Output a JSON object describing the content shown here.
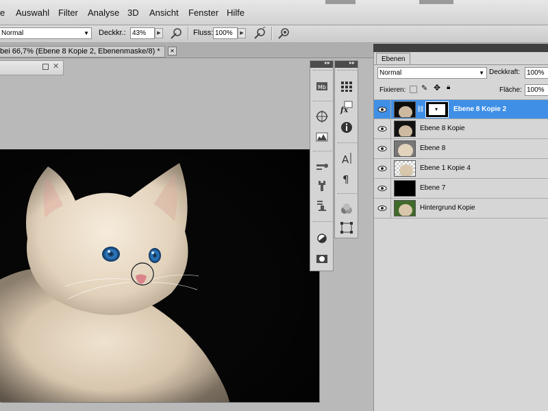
{
  "menu": {
    "items": [
      "e",
      "Auswahl",
      "Filter",
      "Analyse",
      "3D",
      "Ansicht",
      "Fenster",
      "Hilfe"
    ]
  },
  "options": {
    "mode_value": "Normal",
    "opacity_label": "Deckkr.:",
    "opacity_value": "43%",
    "flow_label": "Fluss:",
    "flow_value": "100%"
  },
  "document": {
    "tab_title": "bei 66,7% (Ebene 8 Kopie 2, Ebenenmaske/8) *",
    "close_glyph": "✕"
  },
  "layers_panel": {
    "tab_label": "Ebenen",
    "blend_mode": "Normal",
    "opacity_label": "Deckkraft:",
    "opacity_value": "100%",
    "lock_label": "Fixieren:",
    "fill_label": "Fläche:",
    "fill_value": "100%",
    "layers": [
      {
        "name": "Ebene 8 Kopie 2",
        "selected": true,
        "thumb": "cat-dark",
        "has_mask": true
      },
      {
        "name": "Ebene 8 Kopie",
        "selected": false,
        "thumb": "cat-dark"
      },
      {
        "name": "Ebene 8",
        "selected": false,
        "thumb": "cat-light"
      },
      {
        "name": "Ebene 1 Kopie 4",
        "selected": false,
        "thumb": "cat-transparent"
      },
      {
        "name": "Ebene 7",
        "selected": false,
        "thumb": "black"
      },
      {
        "name": "Hintergrund Kopie",
        "selected": false,
        "thumb": "cat-green"
      }
    ]
  },
  "colors": {
    "selection": "#3f8fe6",
    "panel_bg": "#d6d6d6"
  }
}
